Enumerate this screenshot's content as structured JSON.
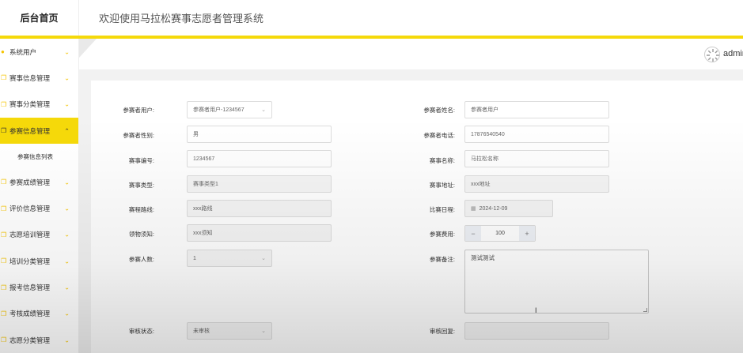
{
  "brand": "后台首页",
  "header_title": "欢迎使用马拉松赛事志愿者管理系统",
  "user": {
    "name": "admin"
  },
  "sidebar": {
    "items": [
      {
        "label": "系统用户"
      },
      {
        "label": "赛事信息管理"
      },
      {
        "label": "赛事分类管理"
      },
      {
        "label": "参赛信息管理",
        "active": true
      },
      {
        "label": "参赛成绩管理"
      },
      {
        "label": "评价信息管理"
      },
      {
        "label": "志愿培训管理"
      },
      {
        "label": "培训分类管理"
      },
      {
        "label": "报考信息管理"
      },
      {
        "label": "考核成绩管理"
      },
      {
        "label": "志愿分类管理"
      }
    ],
    "submenu": {
      "label": "参赛信息列表"
    }
  },
  "form": {
    "user_label": "参赛者用户:",
    "user_value": "参赛者用户-1234567",
    "name_label": "参赛者姓名:",
    "name_value": "参赛者用户",
    "gender_label": "参赛者性别:",
    "gender_value": "男",
    "phone_label": "参赛者电话:",
    "phone_value": "17876540540",
    "event_no_label": "赛事编号:",
    "event_no_value": "1234567",
    "event_name_label": "赛事名称:",
    "event_name_value": "马拉松名称",
    "event_type_label": "赛事类型:",
    "event_type_value": "赛事类型1",
    "event_addr_label": "赛事地址:",
    "event_addr_value": "xxx地址",
    "route_label": "赛程路线:",
    "route_value": "xxx路线",
    "date_label": "比赛日程:",
    "date_value": "2024-12-09",
    "pickup_label": "领物须知:",
    "pickup_value": "xxx须知",
    "fee_label": "参赛费用:",
    "fee_value": "100",
    "count_label": "参赛人数:",
    "count_value": "1",
    "remark_label": "参赛备注:",
    "remark_value": "测试测试",
    "audit_status_label": "审核状态:",
    "audit_status_value": "未审核",
    "audit_reply_label": "审核回复:"
  }
}
